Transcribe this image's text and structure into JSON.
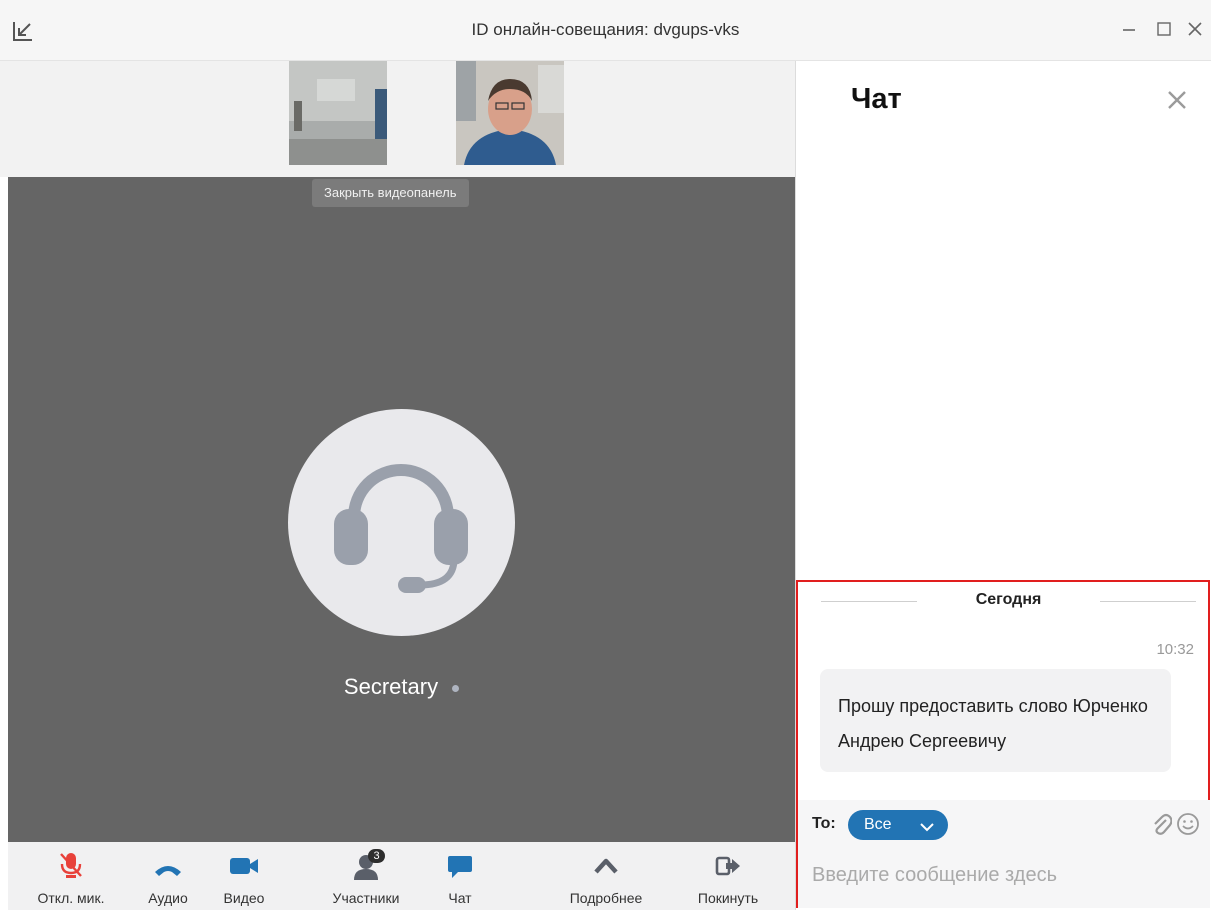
{
  "window": {
    "title": "ID онлайн-совещания: dvgups-vks",
    "icons": [
      "restore-small-icon",
      "minimize-icon",
      "maximize-icon",
      "close-icon"
    ]
  },
  "video_panel": {
    "close_label": "Закрыть видеопанель"
  },
  "stage": {
    "participant_name": "Secretary",
    "avatar_icon": "headset-icon"
  },
  "toolbar": {
    "mute_label": "Откл. мик.",
    "audio_label": "Аудио",
    "video_label": "Видео",
    "participants_label": "Участники",
    "participants_count": "3",
    "chat_label": "Чат",
    "more_label": "Подробнее",
    "leave_label": "Покинуть"
  },
  "chat": {
    "title": "Чат",
    "day_separator": "Сегодня",
    "messages": [
      {
        "time": "10:32",
        "text": "Прошу предоставить слово Юрченко Андрею Сергеевичу"
      }
    ],
    "to_label": "To:",
    "to_value": "Все",
    "input_placeholder": "Введите сообщение здесь"
  },
  "colors": {
    "stage_bg": "#656565",
    "accent_blue": "#2274b4",
    "mute_red": "#e8413a",
    "highlight_red": "#e11e1e"
  }
}
